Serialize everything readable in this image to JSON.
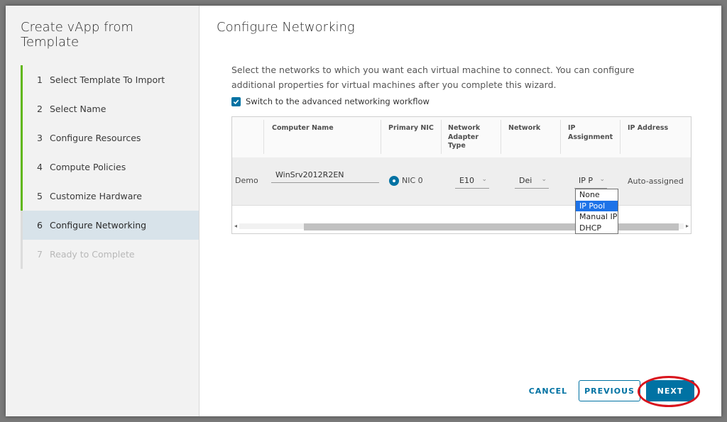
{
  "wizard": {
    "title": "Create vApp from Template",
    "steps": [
      {
        "num": "1",
        "label": "Select Template To Import"
      },
      {
        "num": "2",
        "label": "Select Name"
      },
      {
        "num": "3",
        "label": "Configure Resources"
      },
      {
        "num": "4",
        "label": "Compute Policies"
      },
      {
        "num": "5",
        "label": "Customize Hardware"
      },
      {
        "num": "6",
        "label": "Configure Networking"
      },
      {
        "num": "7",
        "label": "Ready to Complete"
      }
    ]
  },
  "page": {
    "title": "Configure Networking",
    "description": "Select the networks to which you want each virtual machine to connect. You can configure additional properties for virtual machines after you complete this wizard.",
    "advanced_checkbox_label": "Switch to the advanced networking workflow"
  },
  "grid": {
    "columns": [
      "Computer Name",
      "Primary NIC",
      "Network Adapter Type",
      "Network",
      "IP Assignment",
      "IP Address"
    ],
    "row": {
      "vm": "Demo",
      "computer_name": "WinSrv2012R2EN",
      "nic": "NIC 0",
      "adapter": "E10",
      "network": "Dei",
      "ip_assignment": "IP P",
      "ip_address": "Auto-assigned"
    },
    "scroll_left": "◂",
    "scroll_right": "▸"
  },
  "dropdown": {
    "options": [
      "None",
      "IP Pool",
      "Manual IP",
      "DHCP"
    ],
    "highlighted": "IP Pool"
  },
  "footer": {
    "cancel": "CANCEL",
    "previous": "PREVIOUS",
    "next": "NEXT"
  },
  "colors": {
    "accent": "#0072a3",
    "completed_step": "#61b715",
    "annotation": "#d9131c"
  }
}
